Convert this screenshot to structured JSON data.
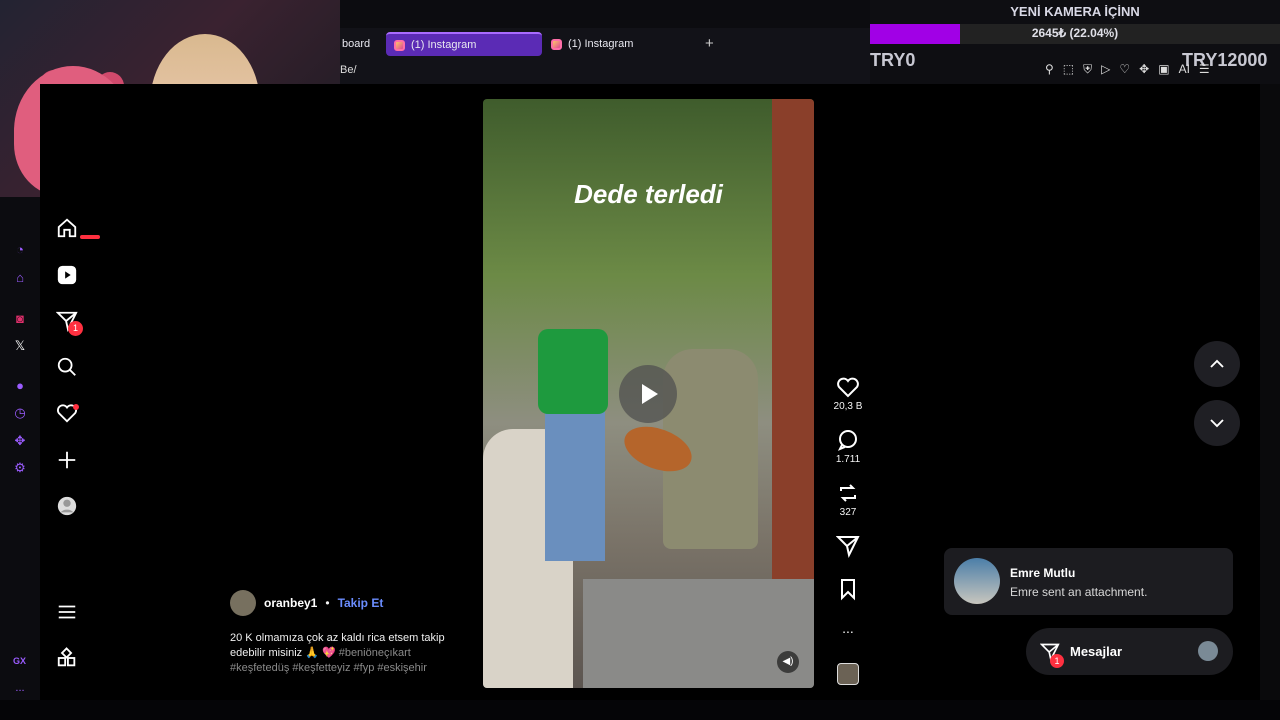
{
  "browser": {
    "tabs": [
      {
        "label": "board"
      },
      {
        "label": "(1) Instagram"
      },
      {
        "label": "(1) Instagram"
      }
    ],
    "new_tab": "+",
    "url": "Be/",
    "accent_color": "#5b2bb5"
  },
  "stream_goal": {
    "title": "YENİ KAMERA İÇİNN",
    "progress_text": "2645₺ (22.04%)",
    "progress_fraction": 0.2204,
    "start_label": "TRY0",
    "end_label": "TRY12000",
    "bar_color": "#a100e6"
  },
  "extension_icons": [
    "pin-icon",
    "crop-icon",
    "shield-icon",
    "play-icon",
    "heart-icon",
    "puzzle-icon",
    "camera-icon",
    "ai-icon",
    "menu-icon"
  ],
  "extension_ai_label": "AI",
  "rail": {
    "items": [
      "speed-dial-icon",
      "extensions-icon",
      "instagram-icon",
      "x-icon",
      "spotify-icon",
      "history-icon",
      "plugins-icon",
      "settings-icon"
    ],
    "x_glyph": "𝕏",
    "gx_label": "GX",
    "more": "..."
  },
  "instagram_nav": {
    "items": [
      "home-icon",
      "reels-icon",
      "messages-icon",
      "search-icon",
      "notifications-icon",
      "create-icon",
      "profile-icon"
    ],
    "messages_badge": "1",
    "bottom": [
      "more-menu-icon",
      "also-from-meta-icon"
    ]
  },
  "reel": {
    "overlay_text": "Dede terledi",
    "author": "oranbey1",
    "separator": "•",
    "follow_label": "Takip Et",
    "caption": "20 K olmamıza çok az kaldı rica etsem takip edebilir misiniz 🙏 💖",
    "hashtags": "#beniöneçıkart #keşfetedüş #keşfetteyiz #fyp #eskişehir"
  },
  "actions": {
    "likes": "20,3 B",
    "comments": "1.711",
    "reposts": "327",
    "more": "..."
  },
  "notification": {
    "title": "Emre Mutlu",
    "body": "Emre sent an attachment."
  },
  "messages_bar": {
    "label": "Mesajlar",
    "badge": "1"
  }
}
